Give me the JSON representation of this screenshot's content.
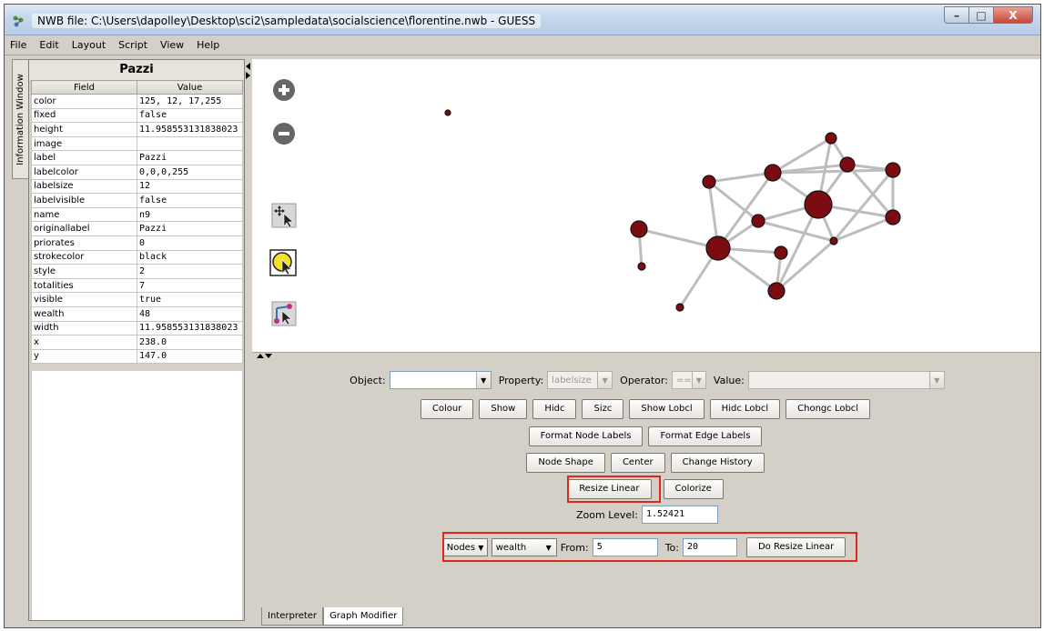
{
  "window": {
    "title": "NWB file: C:\\Users\\dapolley\\Desktop\\sci2\\sampledata\\socialscience\\florentine.nwb - GUESS",
    "controls": [
      "–",
      "□",
      "X"
    ]
  },
  "menu": [
    "File",
    "Edit",
    "Layout",
    "Script",
    "View",
    "Help"
  ],
  "side_tab": "Information Window",
  "info": {
    "title": "Pazzi",
    "headers": [
      "Field",
      "Value"
    ],
    "rows": [
      [
        "color",
        "125, 12, 17,255"
      ],
      [
        "fixed",
        "false"
      ],
      [
        "height",
        "11.958553131838023"
      ],
      [
        "image",
        ""
      ],
      [
        "label",
        "Pazzi"
      ],
      [
        "labelcolor",
        "0,0,0,255"
      ],
      [
        "labelsize",
        "12"
      ],
      [
        "labelvisible",
        "false"
      ],
      [
        "name",
        "n9"
      ],
      [
        "originallabel",
        "Pazzi"
      ],
      [
        "priorates",
        "0"
      ],
      [
        "strokecolor",
        "black"
      ],
      [
        "style",
        "2"
      ],
      [
        "totalities",
        "7"
      ],
      [
        "visible",
        "true"
      ],
      [
        "wealth",
        "48"
      ],
      [
        "width",
        "11.958553131838023"
      ],
      [
        "x",
        "238.0"
      ],
      [
        "y",
        "147.0"
      ]
    ]
  },
  "toolbar_icons": [
    "zoom-in-icon",
    "zoom-out-icon",
    "move-tool-icon",
    "select-tool-icon",
    "edit-nodes-icon"
  ],
  "graph": {
    "node_color": "#7a0c11",
    "edge_color": "#bdbdbd"
  },
  "modifier": {
    "object_label": "Object:",
    "object_value": "",
    "property_label": "Property:",
    "property_value": "labelsize",
    "operator_label": "Operator:",
    "operator_value": "==",
    "value_label": "Value:",
    "value_value": "",
    "row1": [
      "Colour",
      "Show",
      "Hidc",
      "Sizc",
      "Show Lobcl",
      "Hidc Lobcl",
      "Chongc Lobcl"
    ],
    "row2": [
      "Format Node Labels",
      "Format Edge Labels"
    ],
    "row3": [
      "Node Shape",
      "Center",
      "Change History"
    ],
    "resize_linear": "Resize Linear",
    "colorize": "Colorize",
    "zoom_label": "Zoom Level:",
    "zoom_value": "1.52421",
    "resize": {
      "target": "Nodes",
      "property": "wealth",
      "from_label": "From:",
      "from_value": "5",
      "to_label": "To:",
      "to_value": "20",
      "action": "Do Resize Linear"
    },
    "accent_red": "#e1261c"
  },
  "tabs": [
    "Interpreter",
    "Graph Modifier"
  ]
}
